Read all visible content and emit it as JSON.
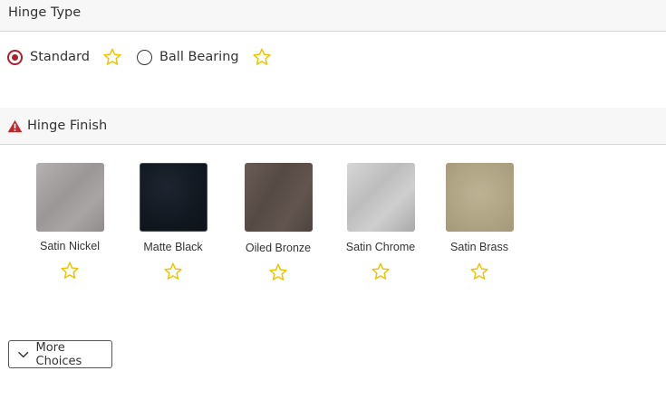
{
  "hinge_type": {
    "title": "Hinge Type",
    "options": [
      {
        "label": "Standard",
        "selected": true
      },
      {
        "label": "Ball Bearing",
        "selected": false
      }
    ]
  },
  "hinge_finish": {
    "title": "Hinge Finish",
    "has_warning": true,
    "swatches": [
      {
        "label": "Satin Nickel",
        "color": "#9e9b9a"
      },
      {
        "label": "Matte Black",
        "color": "#141a22"
      },
      {
        "label": "Oiled Bronze",
        "color": "#5e514c"
      },
      {
        "label": "Satin Chrome",
        "color": "#c3c3c4"
      },
      {
        "label": "Satin Brass",
        "color": "#b3a889"
      }
    ]
  },
  "more_choices": {
    "label": "More Choices"
  },
  "colors": {
    "accent": "#a8232b",
    "warning": "#c0272d",
    "star": "#f2c200"
  },
  "icons": {
    "favorite": "star-outline-icon",
    "warning": "warning-triangle-icon",
    "expand": "chevron-down-icon"
  }
}
